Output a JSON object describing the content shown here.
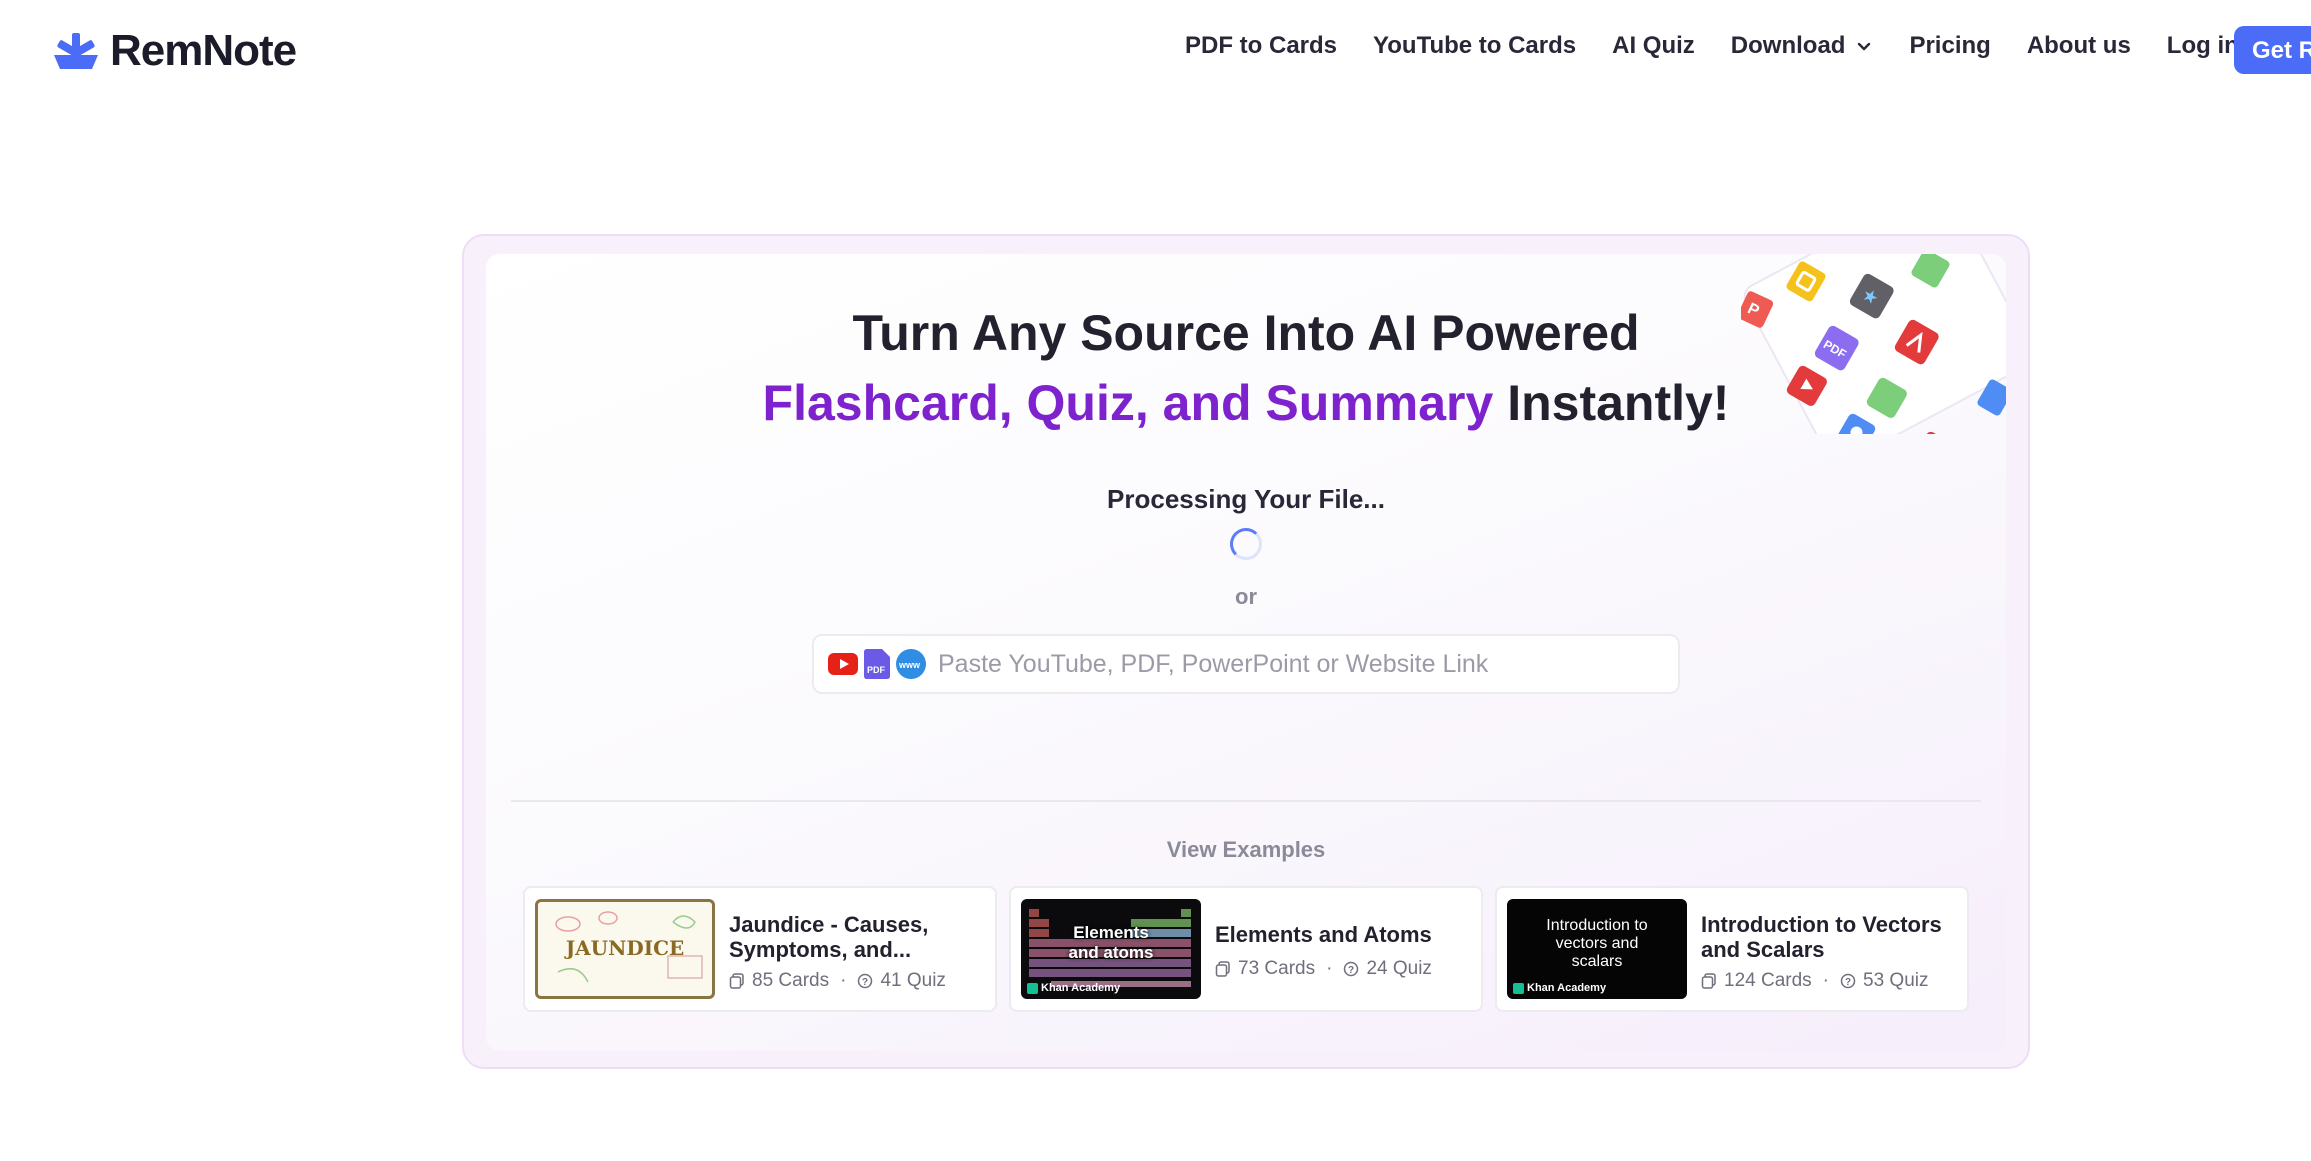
{
  "brand": {
    "name": "RemNote",
    "logo_color": "#4a6cf7"
  },
  "nav": {
    "links": [
      "PDF to Cards",
      "YouTube to Cards",
      "AI Quiz",
      "Download",
      "Pricing",
      "About us",
      "Log in"
    ],
    "cta_label": "Get Re"
  },
  "hero": {
    "title_line1": "Turn Any Source Into AI Powered",
    "title_highlight": "Flashcard, Quiz, and Summary",
    "title_tail": " Instantly!",
    "highlight_color": "#7e22ce",
    "status": "Processing Your File...",
    "or_label": "or",
    "link_placeholder": "Paste YouTube, PDF, PowerPoint or Website Link"
  },
  "examples": {
    "heading": "View Examples",
    "items": [
      {
        "title": "Jaundice - Causes, Symptoms, and...",
        "cards": "85 Cards",
        "quiz": "41 Quiz",
        "thumb_text": "JAUNDICE"
      },
      {
        "title": "Elements and Atoms",
        "cards": "73 Cards",
        "quiz": "24 Quiz",
        "thumb_text": "Elements and atoms",
        "thumb_badge": "Khan Academy"
      },
      {
        "title": "Introduction to Vectors and Scalars",
        "cards": "124 Cards",
        "quiz": "53 Quiz",
        "thumb_text": "Introduction to vectors and scalars",
        "thumb_badge": "Khan Academy"
      }
    ]
  }
}
